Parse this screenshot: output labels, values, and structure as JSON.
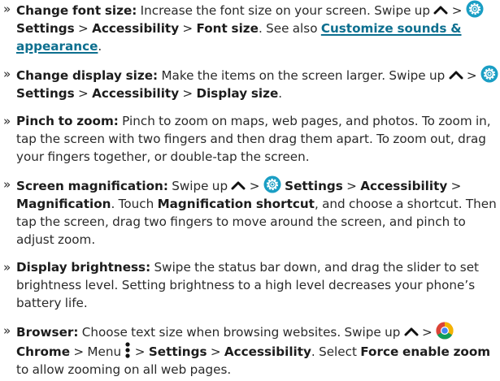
{
  "bullet": "»",
  "sep": ">",
  "accent_color": "#1a9ec4",
  "link_color": "#0d6f8f",
  "items": [
    {
      "label": "Change font size:",
      "text1": "Increase the font size on your screen. Swipe up",
      "settings": "Settings",
      "accessibility": "Accessibility",
      "target": "Font size",
      "see_also": ". See also",
      "link": "Customize sounds & appearance",
      "end": "."
    },
    {
      "label": "Change display size:",
      "text1": "Make the items on the screen larger. Swipe up",
      "settings": "Settings",
      "accessibility": "Accessibility",
      "target": "Display size",
      "end": "."
    },
    {
      "label": "Pinch to zoom:",
      "text1": "Pinch to zoom on maps, web pages, and photos. To zoom in, tap the screen with two fingers and then drag them apart. To zoom out, drag your fingers together, or double-tap the screen."
    },
    {
      "label": "Screen magnification:",
      "text1": "Swipe up",
      "settings": "Settings",
      "accessibility": "Accessibility",
      "target": "Magnification",
      "text2": ". Touch",
      "shortcut": "Magnification shortcut",
      "text3": ", and choose a shortcut. Then tap the screen, drag two fingers to move around the screen, and pinch to adjust zoom."
    },
    {
      "label": "Display brightness:",
      "text1": "Swipe the status bar down, and drag the slider to set brightness level. Setting brightness to a high level decreases your phone’s battery life."
    },
    {
      "label": "Browser:",
      "text1": "Choose text size when browsing websites. Swipe up",
      "chrome": "Chrome",
      "menu": "Menu",
      "settings": "Settings",
      "accessibility": "Accessibility",
      "text2": ". Select",
      "force": "Force enable zoom",
      "text3": "to allow zooming on all web pages."
    }
  ],
  "icons": [
    "bullet",
    "caret-up-icon",
    "settings-gear-icon",
    "chrome-icon",
    "menu-kebab-icon"
  ]
}
